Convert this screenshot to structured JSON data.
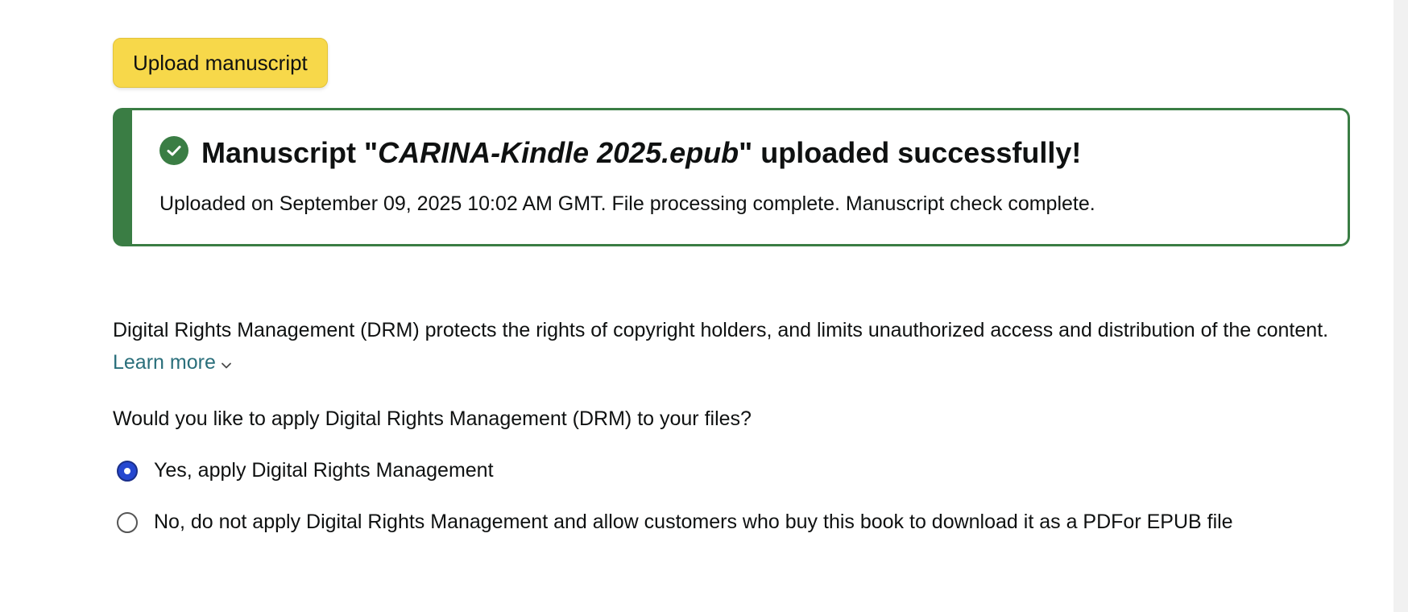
{
  "upload": {
    "button_label": "Upload manuscript"
  },
  "alert": {
    "heading_prefix": "Manuscript \"",
    "filename": "CARINA-Kindle 2025.epub",
    "heading_suffix": "\" uploaded successfully!",
    "detail": "Uploaded on September 09, 2025 10:02 AM GMT. File processing complete. Manuscript check complete.",
    "status_color": "#3a7d44",
    "icon": "check-circle-icon"
  },
  "drm": {
    "description": "Digital Rights Management (DRM) protects the rights of copyright holders, and limits unauthorized access and distribution of the content.",
    "learn_more_label": "Learn more",
    "learn_more_icon": "chevron-down-icon",
    "question": "Would you like to apply Digital Rights Management (DRM) to your files?",
    "options": [
      {
        "label": "Yes, apply Digital Rights Management",
        "selected": true
      },
      {
        "label": "No, do not apply Digital Rights Management and allow customers who buy this book to download it as a PDFor EPUB file",
        "selected": false
      }
    ]
  },
  "colors": {
    "button_yellow": "#f7d84a",
    "link_teal": "#2a6f7b",
    "radio_selected": "#2547d0"
  }
}
